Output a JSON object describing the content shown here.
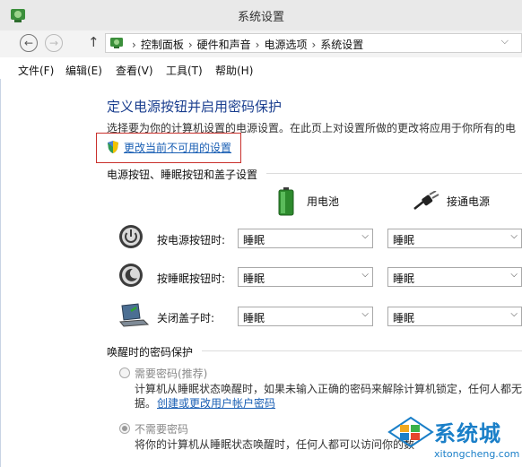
{
  "window": {
    "title": "系统设置"
  },
  "nav": {
    "back_glyph": "←",
    "forward_glyph": "→",
    "up_glyph": "↑",
    "breadcrumbs": [
      "控制面板",
      "硬件和声音",
      "电源选项",
      "系统设置"
    ],
    "separator": "›",
    "dropdown_glyph": "⌵"
  },
  "menu": {
    "items": [
      "文件(F)",
      "编辑(E)",
      "查看(V)",
      "工具(T)",
      "帮助(H)"
    ]
  },
  "main": {
    "heading": "定义电源按钮并启用密码保护",
    "description": "选择要为你的计算机设置的电源设置。在此页上对设置所做的更改将应用于你所有的电",
    "change_link": "更改当前不可用的设置",
    "buttons_section": "电源按钮、睡眠按钮和盖子设置",
    "col_battery": "用电池",
    "col_plugged": "接通电源",
    "rows": [
      {
        "label": "按电源按钮时:",
        "battery": "睡眠",
        "plugged": "睡眠",
        "icon": "power-icon"
      },
      {
        "label": "按睡眠按钮时:",
        "battery": "睡眠",
        "plugged": "睡眠",
        "icon": "sleep-icon"
      },
      {
        "label": "关闭盖子时:",
        "battery": "睡眠",
        "plugged": "睡眠",
        "icon": "laptop-lid-icon"
      }
    ],
    "password_section": "唤醒时的密码保护",
    "require_label": "需要密码(推荐)",
    "require_desc_1": "计算机从睡眠状态唤醒时，如果未输入正确的密码来解除计算机锁定，任何人都无",
    "require_desc_2": "据。",
    "account_link": "创建或更改用户帐户密码",
    "no_require_label": "不需要密码",
    "no_require_desc": "将你的计算机从睡眠状态唤醒时，任何人都可以访问你的数"
  },
  "watermark": {
    "brand": "系统城",
    "url": "xitongcheng.com"
  },
  "colors": {
    "link": "#1a5fb4",
    "heading": "#1a3e8f",
    "highlight_box": "#c9302c"
  }
}
